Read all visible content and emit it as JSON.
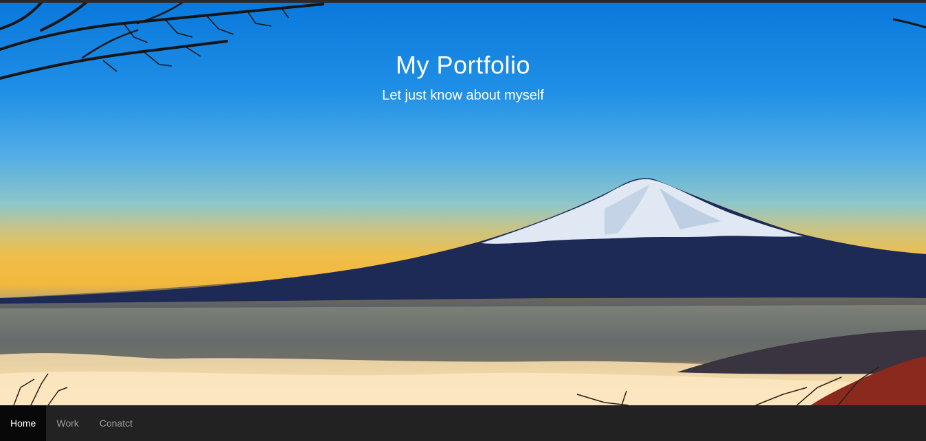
{
  "hero": {
    "title": "My Portfolio",
    "subtitle": "Let just know about myself",
    "background_image": "mountain-landscape-image"
  },
  "navbar": {
    "items": [
      {
        "label": "Home",
        "active": true
      },
      {
        "label": "Work",
        "active": false
      },
      {
        "label": "Conatct",
        "active": false
      }
    ],
    "colors": {
      "background": "#222222",
      "active_background": "#080808",
      "text": "#9d9d9d",
      "active_text": "#ffffff"
    }
  }
}
